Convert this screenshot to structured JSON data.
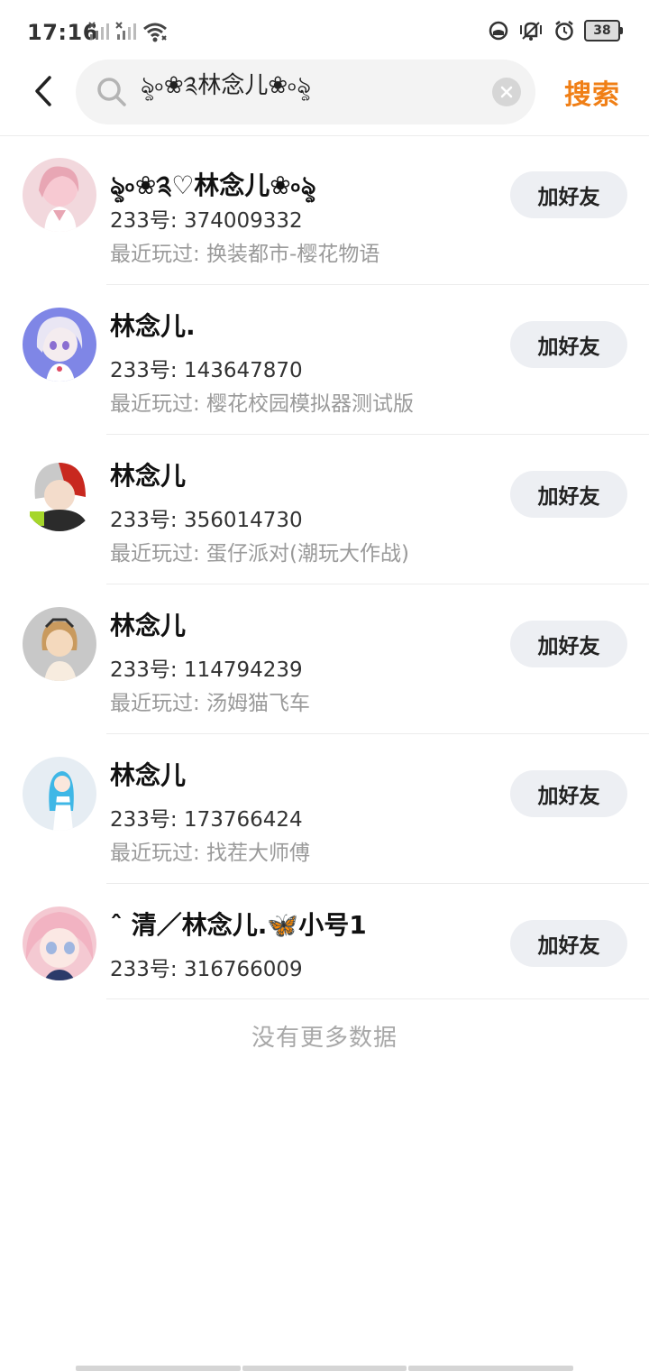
{
  "status_bar": {
    "time": "17:16",
    "battery": "38"
  },
  "search": {
    "query": "ৡ৹❀༉林念儿❀৹ৡ",
    "submit_label": "搜索"
  },
  "results": [
    {
      "nickname": "ৡ৹❀༉♡林念儿❀৹ৡ",
      "id": "233号: 374009332",
      "recent": "最近玩过: 换装都市-樱花物语",
      "add_label": "加好友",
      "avatar_colors": [
        "#f2d8dd",
        "#e8a6b4"
      ]
    },
    {
      "nickname": "林念儿.",
      "id": "233号: 143647870",
      "recent": "最近玩过: 樱花校园模拟器测试版",
      "add_label": "加好友",
      "avatar_colors": [
        "#7f86e6",
        "#e9e6f4"
      ]
    },
    {
      "nickname": "林念儿",
      "id": "233号: 356014730",
      "recent": "最近玩过: 蛋仔派对(潮玩大作战)",
      "add_label": "加好友",
      "avatar_colors": [
        "#2b2b2b",
        "#c9c9c9"
      ]
    },
    {
      "nickname": "林念儿",
      "id": "233号: 114794239",
      "recent": "最近玩过: 汤姆猫飞车",
      "add_label": "加好友",
      "avatar_colors": [
        "#c8c8c8",
        "#e2b98a"
      ]
    },
    {
      "nickname": "林念儿",
      "id": "233号: 173766424",
      "recent": "最近玩过: 找茬大师傅",
      "add_label": "加好友",
      "avatar_colors": [
        "#e6edf3",
        "#3fb7e6"
      ]
    },
    {
      "nickname": "ˆ 清／林念儿.🦋小号1",
      "id": "233号: 316766009",
      "recent": "",
      "add_label": "加好友",
      "avatar_colors": [
        "#f4c9d2",
        "#9fb6e0"
      ]
    }
  ],
  "footer": {
    "no_more_text": "没有更多数据"
  },
  "colors": {
    "accent": "#f07f16",
    "button_bg": "#edeff3",
    "secondary_text": "#9a9a9a"
  },
  "icons": [
    "back-icon",
    "search-icon",
    "clear-icon",
    "wifi-icon",
    "signal-icon",
    "vibrate-icon",
    "alarm-icon",
    "battery-icon"
  ]
}
